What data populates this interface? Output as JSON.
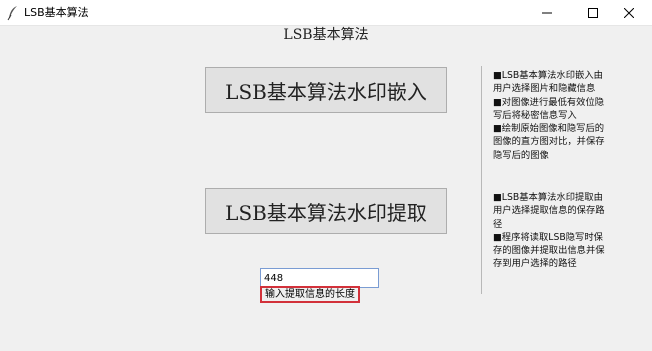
{
  "window": {
    "title": "LSB基本算法",
    "icon": "feather-icon",
    "controls": [
      "minimize-icon",
      "maximize-icon",
      "close-icon"
    ]
  },
  "main": {
    "heading": "LSB基本算法",
    "embed_button": "LSB基本算法水印嵌入",
    "extract_button": "LSB基本算法水印提取",
    "length_input_value": "448",
    "length_label": "输入提取信息的长度"
  },
  "help": {
    "embed": [
      "■LSB基本算法水印嵌入由",
      "用户选择图片和隐藏信息",
      "■对图像进行最低有效位隐",
      "写后将秘密信息写入",
      "■绘制原始图像和隐写后的",
      "图像的直方图对比，并保存",
      "隐写后的图像"
    ],
    "extract": [
      "■LSB基本算法水印提取由",
      "用户选择提取信息的保存路",
      "径",
      "■程序将读取LSB隐写时保",
      "存的图像并提取出信息并保",
      "存到用户选择的路径"
    ]
  },
  "colors": {
    "background": "#f0f0f0",
    "button_face": "#e1e1e1",
    "label_border": "#d2313a",
    "input_border": "#7a9cd3"
  }
}
